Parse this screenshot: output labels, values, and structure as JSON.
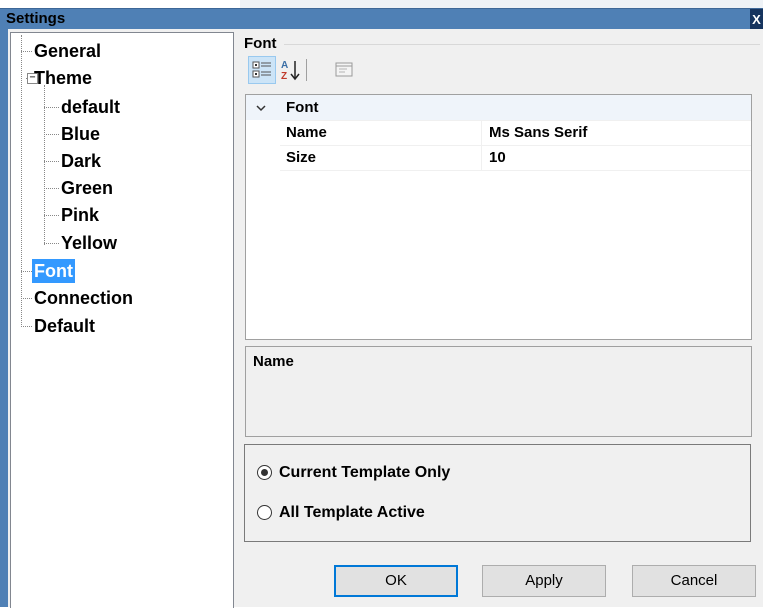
{
  "window": {
    "title": "Settings",
    "close_label": "X"
  },
  "tree": {
    "items": [
      {
        "label": "General"
      },
      {
        "label": "Theme",
        "expanded": true
      },
      {
        "label": "default"
      },
      {
        "label": "Blue"
      },
      {
        "label": "Dark"
      },
      {
        "label": "Green"
      },
      {
        "label": "Pink"
      },
      {
        "label": "Yellow"
      },
      {
        "label": "Font",
        "selected": true
      },
      {
        "label": "Connection"
      },
      {
        "label": "Default"
      }
    ]
  },
  "font_group": {
    "label": "Font",
    "toolbar": {
      "categorized": "categorized-view-icon",
      "alphabetical": "sort-az-icon",
      "property_pages": "property-pages-icon"
    },
    "grid": {
      "category": "Font",
      "rows": [
        {
          "name": "Name",
          "value": "Ms Sans Serif"
        },
        {
          "name": "Size",
          "value": "10"
        }
      ]
    },
    "description": {
      "title": "Name"
    }
  },
  "template_options": {
    "options": [
      {
        "label": "Current Template Only",
        "checked": true
      },
      {
        "label": "All Template Active",
        "checked": false
      }
    ]
  },
  "buttons": {
    "ok": "OK",
    "apply": "Apply",
    "cancel": "Cancel"
  },
  "colors": {
    "titlebar": "#4f80b5",
    "selection": "#3399ff",
    "default_button_border": "#0078d7"
  }
}
